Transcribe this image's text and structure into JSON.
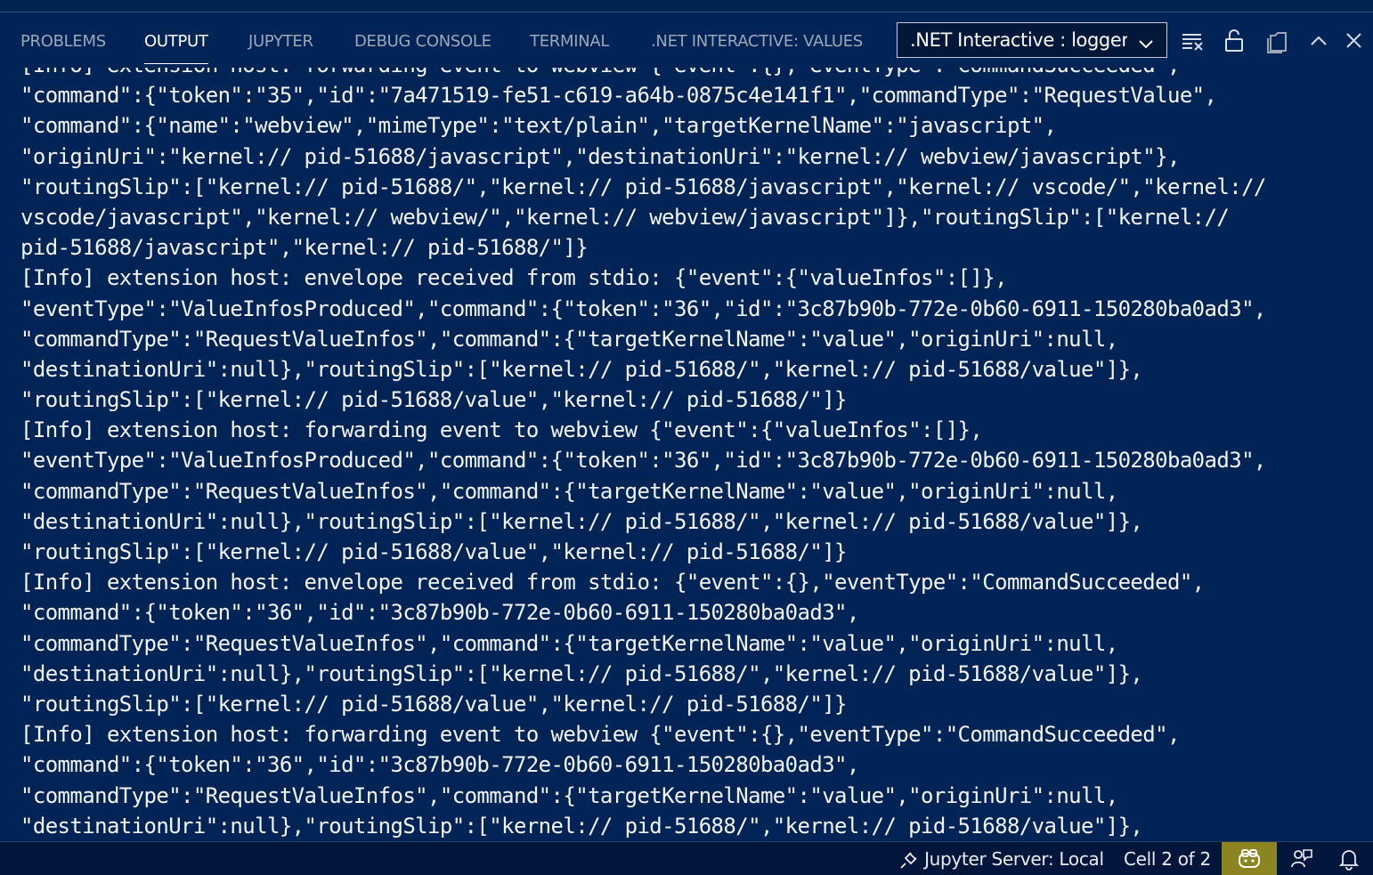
{
  "panel": {
    "tabs": [
      {
        "label": "PROBLEMS"
      },
      {
        "label": "OUTPUT"
      },
      {
        "label": "JUPYTER"
      },
      {
        "label": "DEBUG CONSOLE"
      },
      {
        "label": "TERMINAL"
      },
      {
        "label": ".NET INTERACTIVE: VALUES"
      }
    ],
    "active_tab": "OUTPUT",
    "channel_select": {
      "value": ".NET Interactive : logger"
    },
    "toolbar_icons": [
      "clear-output-icon",
      "lock-scroll-icon",
      "open-output-in-editor-icon",
      "maximize-panel-icon",
      "close-panel-icon"
    ]
  },
  "output": {
    "lines": [
      "[Info] extension host: forwarding event to webview {\"event\":{},\"eventType\":\"CommandSucceeded\",",
      "\"command\":{\"token\":\"35\",\"id\":\"7a471519-fe51-c619-a64b-0875c4e141f1\",\"commandType\":\"RequestValue\",",
      "\"command\":{\"name\":\"webview\",\"mimeType\":\"text/plain\",\"targetKernelName\":\"javascript\",",
      "\"originUri\":\"kernel:// pid-51688/javascript\",\"destinationUri\":\"kernel:// webview/javascript\"},",
      "\"routingSlip\":[\"kernel:// pid-51688/\",\"kernel:// pid-51688/javascript\",\"kernel:// vscode/\",\"kernel://",
      "vscode/javascript\",\"kernel:// webview/\",\"kernel:// webview/javascript\"]},\"routingSlip\":[\"kernel://",
      "pid-51688/javascript\",\"kernel:// pid-51688/\"]}",
      "[Info] extension host: envelope received from stdio: {\"event\":{\"valueInfos\":[]},",
      "\"eventType\":\"ValueInfosProduced\",\"command\":{\"token\":\"36\",\"id\":\"3c87b90b-772e-0b60-6911-150280ba0ad3\",",
      "\"commandType\":\"RequestValueInfos\",\"command\":{\"targetKernelName\":\"value\",\"originUri\":null,",
      "\"destinationUri\":null},\"routingSlip\":[\"kernel:// pid-51688/\",\"kernel:// pid-51688/value\"]},",
      "\"routingSlip\":[\"kernel:// pid-51688/value\",\"kernel:// pid-51688/\"]}",
      "[Info] extension host: forwarding event to webview {\"event\":{\"valueInfos\":[]},",
      "\"eventType\":\"ValueInfosProduced\",\"command\":{\"token\":\"36\",\"id\":\"3c87b90b-772e-0b60-6911-150280ba0ad3\",",
      "\"commandType\":\"RequestValueInfos\",\"command\":{\"targetKernelName\":\"value\",\"originUri\":null,",
      "\"destinationUri\":null},\"routingSlip\":[\"kernel:// pid-51688/\",\"kernel:// pid-51688/value\"]},",
      "\"routingSlip\":[\"kernel:// pid-51688/value\",\"kernel:// pid-51688/\"]}",
      "[Info] extension host: envelope received from stdio: {\"event\":{},\"eventType\":\"CommandSucceeded\",",
      "\"command\":{\"token\":\"36\",\"id\":\"3c87b90b-772e-0b60-6911-150280ba0ad3\",",
      "\"commandType\":\"RequestValueInfos\",\"command\":{\"targetKernelName\":\"value\",\"originUri\":null,",
      "\"destinationUri\":null},\"routingSlip\":[\"kernel:// pid-51688/\",\"kernel:// pid-51688/value\"]},",
      "\"routingSlip\":[\"kernel:// pid-51688/value\",\"kernel:// pid-51688/\"]}",
      "[Info] extension host: forwarding event to webview {\"event\":{},\"eventType\":\"CommandSucceeded\",",
      "\"command\":{\"token\":\"36\",\"id\":\"3c87b90b-772e-0b60-6911-150280ba0ad3\",",
      "\"commandType\":\"RequestValueInfos\",\"command\":{\"targetKernelName\":\"value\",\"originUri\":null,",
      "\"destinationUri\":null},\"routingSlip\":[\"kernel:// pid-51688/\",\"kernel:// pid-51688/value\"]},"
    ]
  },
  "statusbar": {
    "jupyter_server": "Jupyter Server: Local",
    "cell_position": "Cell 2 of 2",
    "icons": [
      "plug-icon",
      "copilot-icon",
      "feedback-icon",
      "bell-icon"
    ]
  },
  "colors": {
    "background": "#012456",
    "text": "#f2f4f8",
    "inactive_tab": "#9ca7b9",
    "copilot_highlight": "#8b8420"
  }
}
